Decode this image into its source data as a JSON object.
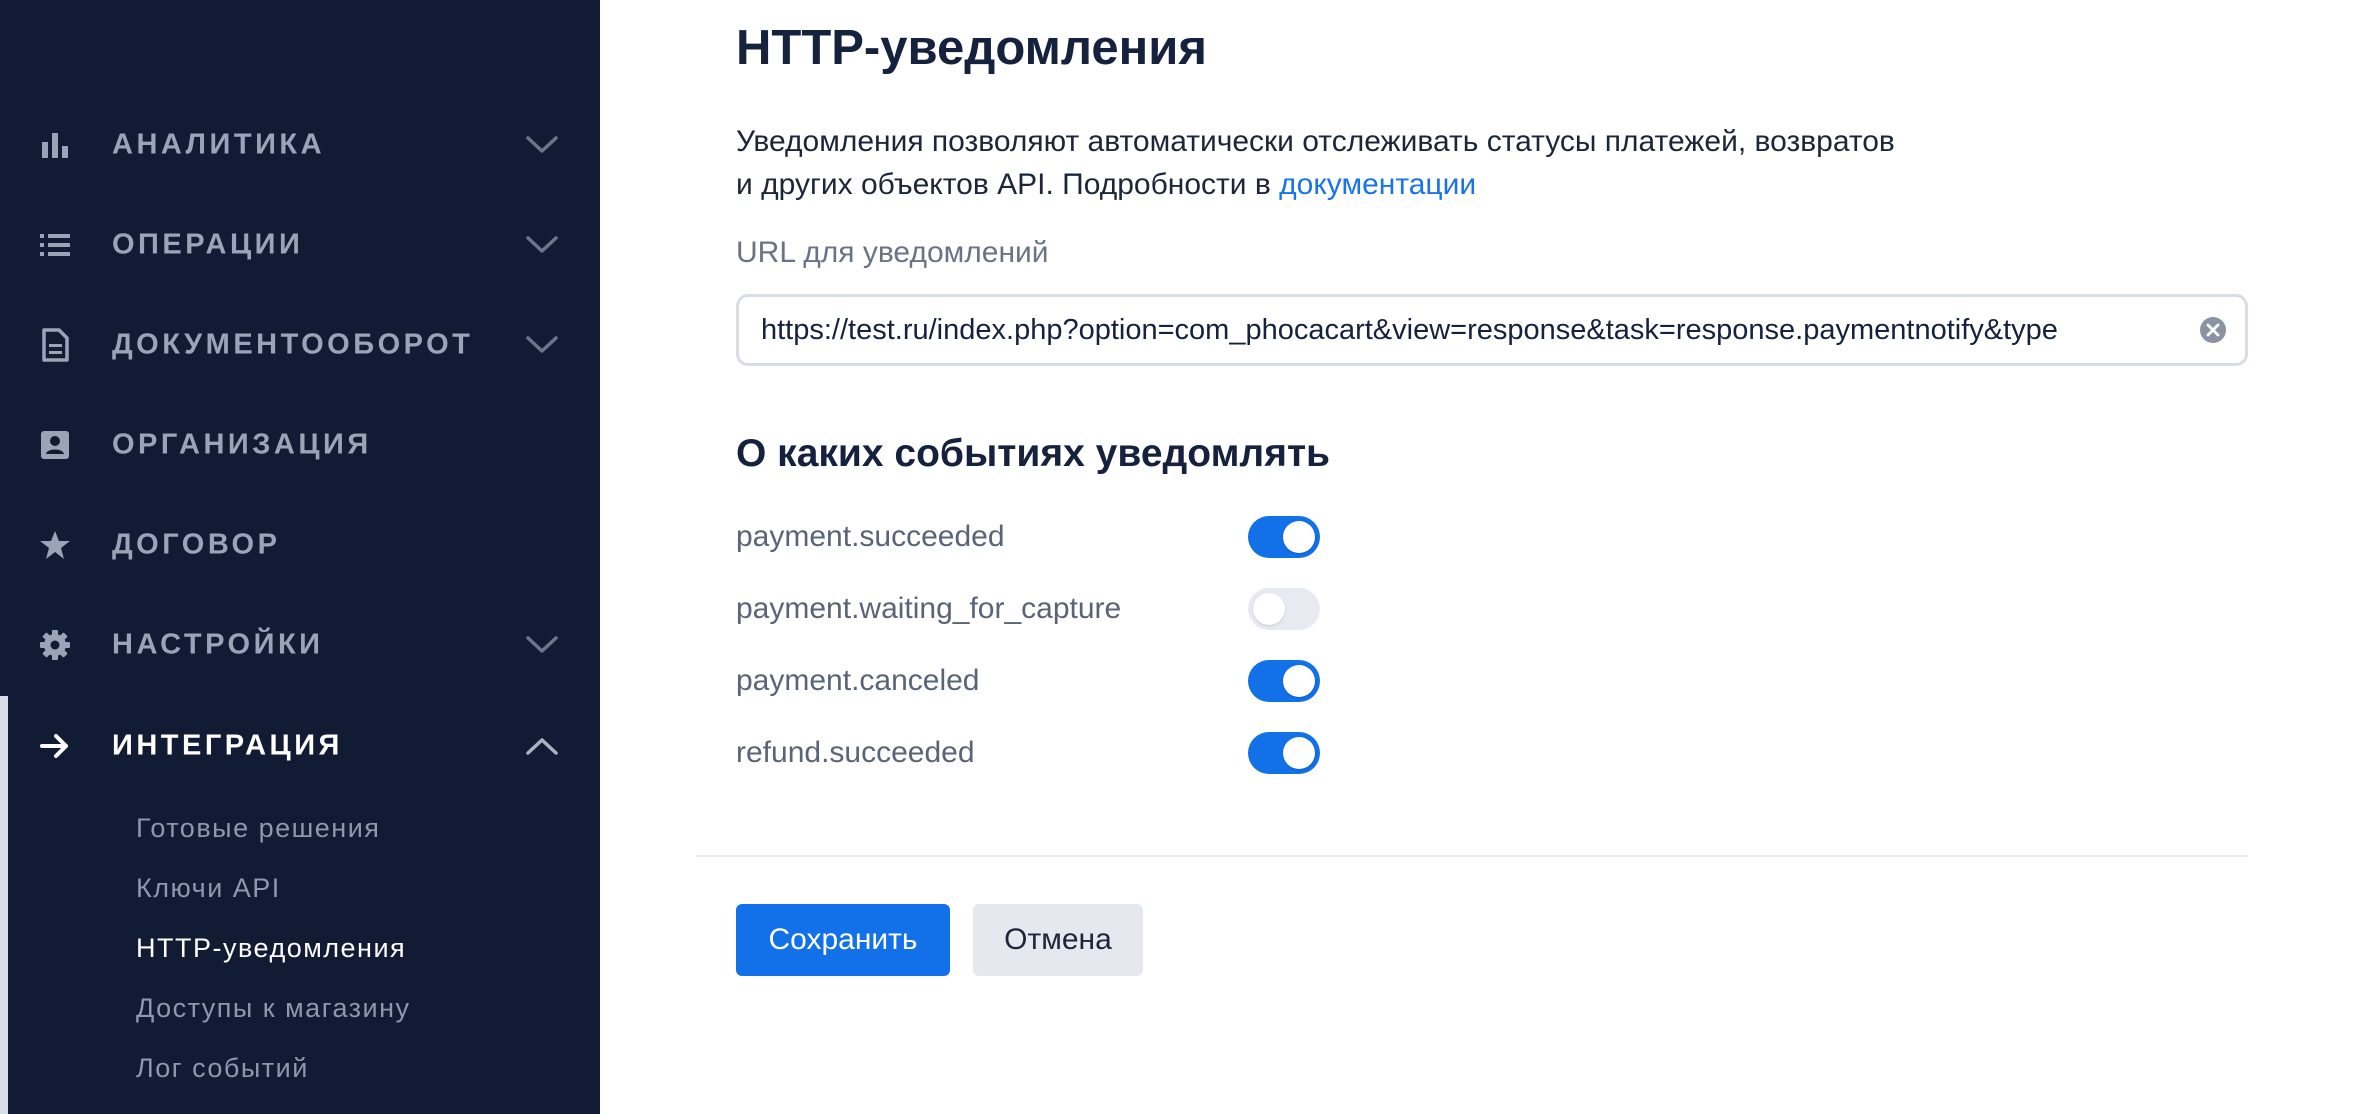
{
  "sidebar": {
    "items": [
      {
        "label": "АНАЛИТИКА",
        "icon": "bar-chart-icon",
        "chevron": "down"
      },
      {
        "label": "ОПЕРАЦИИ",
        "icon": "list-icon",
        "chevron": "down"
      },
      {
        "label": "ДОКУМЕНТООБОРОТ",
        "icon": "document-icon",
        "chevron": "down"
      },
      {
        "label": "ОРГАНИЗАЦИЯ",
        "icon": "id-card-icon"
      },
      {
        "label": "ДОГОВОР",
        "icon": "star-icon"
      },
      {
        "label": "НАСТРОЙКИ",
        "icon": "gear-icon",
        "chevron": "down"
      },
      {
        "label": "ИНТЕГРАЦИЯ",
        "icon": "arrow-right-icon",
        "chevron": "up",
        "active": true
      }
    ],
    "subitems": [
      {
        "label": "Готовые решения"
      },
      {
        "label": "Ключи API"
      },
      {
        "label": "HTTP-уведомления",
        "active": true
      },
      {
        "label": "Доступы к магазину"
      },
      {
        "label": "Лог событий"
      }
    ]
  },
  "main": {
    "title": "HTTP-уведомления",
    "description_line1": "Уведомления позволяют автоматически отслеживать статусы платежей, возвратов",
    "description_line2": "и других объектов API. Подробности в ",
    "description_link": "документации",
    "url_label": "URL для уведомлений",
    "url_value": "https://test.ru/index.php?option=com_phocacart&view=response&task=response.paymentnotify&type",
    "events_title": "О каких событиях уведомлять",
    "events": [
      {
        "name": "payment.succeeded",
        "enabled": true
      },
      {
        "name": "payment.waiting_for_capture",
        "enabled": false
      },
      {
        "name": "payment.canceled",
        "enabled": true
      },
      {
        "name": "refund.succeeded",
        "enabled": true
      }
    ],
    "save_label": "Сохранить",
    "cancel_label": "Отмена"
  },
  "colors": {
    "sidebar_bg": "#111b33",
    "accent": "#1270e8",
    "link": "#1a73e8",
    "toggle_off": "#e7eaf0"
  }
}
